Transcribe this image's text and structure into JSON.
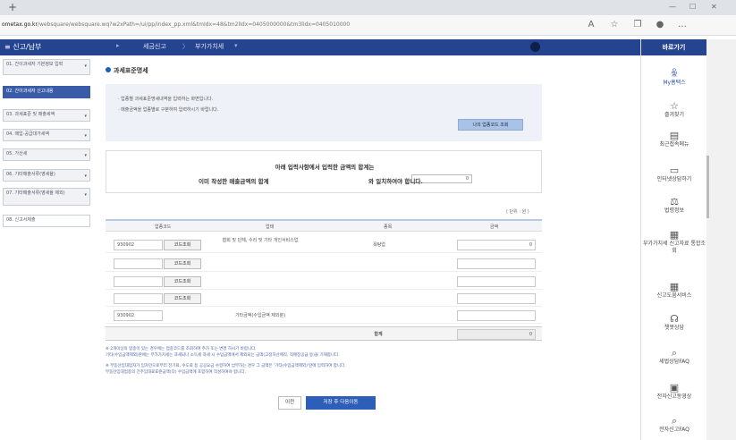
{
  "browser": {
    "url_prefix": "ometax.go.kr",
    "url_rest": "/websquare/websquare.wq?w2xPath=/ui/pp/index_pp.xml&tmIdx=48&tm2lIdx=0405000000&tm3lIdx=0405010000"
  },
  "nav": {
    "menu_label": "≡ 신고/납부",
    "crumb1": "세금신고",
    "crumb2": "부가가치세"
  },
  "sidebar": {
    "items": [
      {
        "label": "01. 간이과세자 기본정보 입력"
      },
      {
        "label": "02. 간이과세자 신고내용"
      },
      {
        "label": "03. 과세표준 및 매출세액"
      },
      {
        "label": "04. 매입·공급대가세액"
      },
      {
        "label": "05. 가산세"
      },
      {
        "label": "06. 기타매출서류(영세율)"
      },
      {
        "label": "07. 기타매출서류(영세율 제외)"
      },
      {
        "label": "08. 신고서제출"
      }
    ]
  },
  "quick_menu": {
    "title": "바로가기",
    "items": [
      {
        "label": "My홈택스",
        "icon": "person-icon"
      },
      {
        "label": "즐겨찾기",
        "icon": "star-icon"
      },
      {
        "label": "최근접속메뉴",
        "icon": "clipboard-icon"
      },
      {
        "label": "인터넷상담하기",
        "icon": "monitor-icon"
      },
      {
        "label": "법령정보",
        "icon": "scales-icon"
      },
      {
        "label": "부가가치세 신고자료 통합조회",
        "icon": "grid-icon"
      },
      {
        "label": "신고도움서비스",
        "icon": "grid-icon"
      },
      {
        "label": "챗봇상담",
        "icon": "headset-icon"
      },
      {
        "label": "세법상담FAQ",
        "icon": "search-icon"
      },
      {
        "label": "전자신고동영상",
        "icon": "play-icon"
      },
      {
        "label": "전자신고FAQ",
        "icon": "search-icon"
      }
    ]
  },
  "main": {
    "section_title": "과세표준명세",
    "info_line1": "· 업종별 과세표준명세내역을 입력하는 화면입니다.",
    "info_line2": "· 매출금액을 업종별로 구분하여 입력하시기 바랍니다.",
    "code_lookup_btn": "나의 업종코드 조회",
    "sum_line1": "아래 입력사항에서 입력한 금액의 합계는",
    "sum_line2_prefix": "이미 작성한 매출금액의 합계",
    "sum_value": "0",
    "sum_line2_suffix": "와 일치하여야 합니다.",
    "unit": "( 단위 : 원 )",
    "table": {
      "headers": {
        "code": "업종코드",
        "biz": "업태",
        "item": "종목",
        "amount": "금액"
      },
      "rows": [
        {
          "code": "930902",
          "btn": "코드조회",
          "biz": "협회 및 단체, 수리 및 기타 개인서비스업",
          "item": "욕탕업",
          "amount": "0"
        },
        {
          "code": "",
          "btn": "코드조회",
          "biz": "",
          "item": "",
          "amount": ""
        },
        {
          "code": "",
          "btn": "코드조회",
          "biz": "",
          "item": "",
          "amount": ""
        },
        {
          "code": "",
          "btn": "코드조회",
          "biz": "",
          "item": "",
          "amount": ""
        },
        {
          "code": "930902",
          "btn": "",
          "biz": "기타금액(수입금액 제외분)",
          "item": "",
          "amount": ""
        }
      ],
      "total_label": "합계",
      "total_value": "0"
    },
    "notes": [
      "※ 2개이상의 업종이 있는 경우에는 업종코드를 조회하여 추가 또는 변경 하시기 바랍니다.",
      "   기타(수입금액제외)란에는 부가가치세는 과세되나 소득세 과세 시 수입금액에서 제외되는 금액(고정자산매각, 직매장공급 등)을 기재합니다.",
      "※ 부동산임대업자가 임차인으로부터 전기료, 수도료 등 공공요금 수령하여 납부하는 경우 그 금액은 '기타(수입금액제외)'란에 입력하여 합니다.",
      "   부동산임대업종의 간주임대료표준금액(다) 수입금액에 포함하여 작성하여야 합니다."
    ],
    "btn_prev": "이전",
    "btn_next": "저장 후 다음이동"
  }
}
